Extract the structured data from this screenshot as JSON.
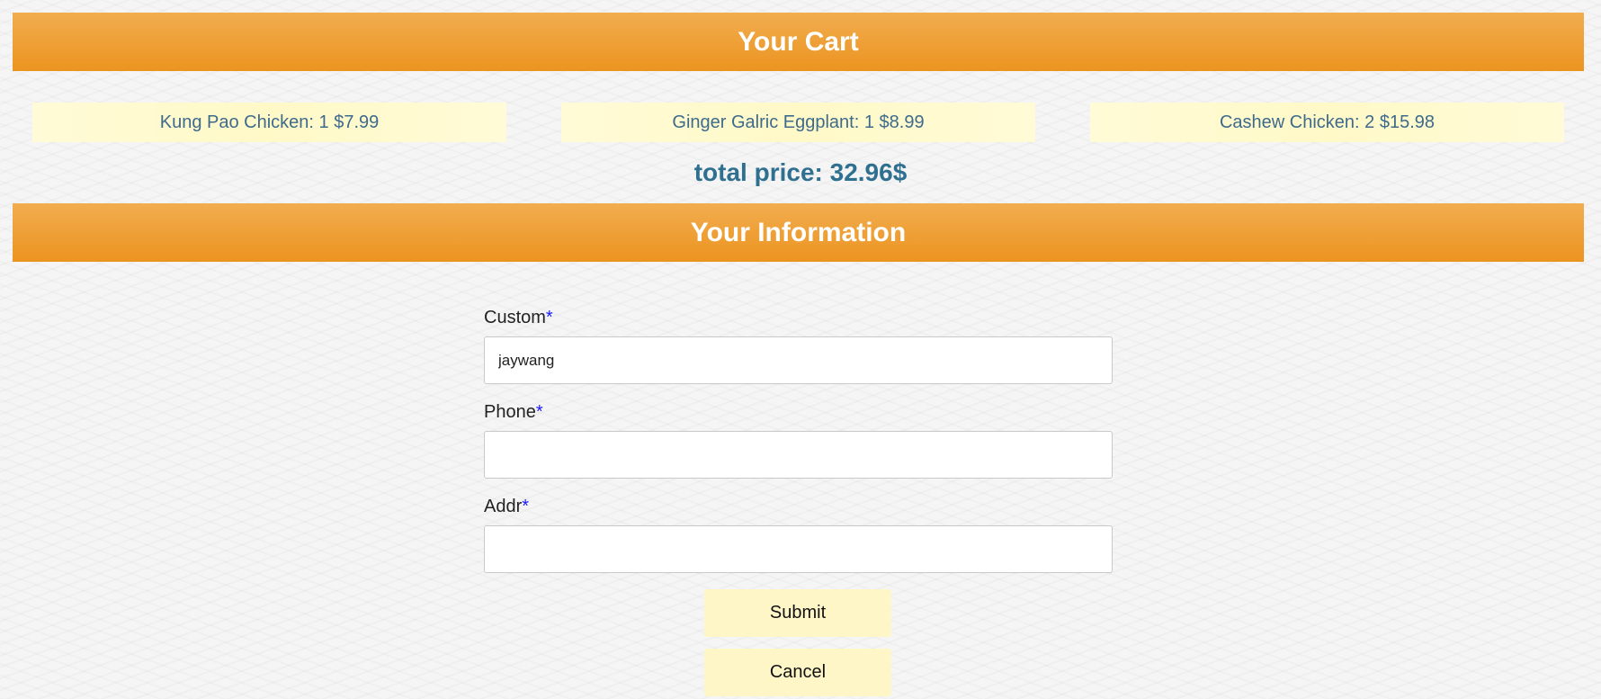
{
  "cart": {
    "title": "Your Cart",
    "items": [
      {
        "label": "Kung Pao Chicken: 1 $7.99"
      },
      {
        "label": "Ginger Galric Eggplant: 1 $8.99"
      },
      {
        "label": "Cashew Chicken: 2 $15.98"
      }
    ],
    "total": "total price: 32.96$"
  },
  "info": {
    "title": "Your Information",
    "required_marker": "*",
    "fields": [
      {
        "label": "Custom",
        "value": "jaywang",
        "placeholder": ""
      },
      {
        "label": "Phone",
        "value": "",
        "placeholder": ""
      },
      {
        "label": "Addr",
        "value": "",
        "placeholder": ""
      }
    ]
  },
  "actions": {
    "submit_label": "Submit",
    "cancel_label": "Cancel"
  },
  "colors": {
    "banner_top": "#f1ad4f",
    "banner_bottom": "#ec9420",
    "cart_item_bg": "#fffbd6",
    "cart_item_text": "#3e6a8c",
    "total_text": "#2f6f8f",
    "button_bg": "#fff6c7",
    "required_marker": "#1a1aff"
  }
}
